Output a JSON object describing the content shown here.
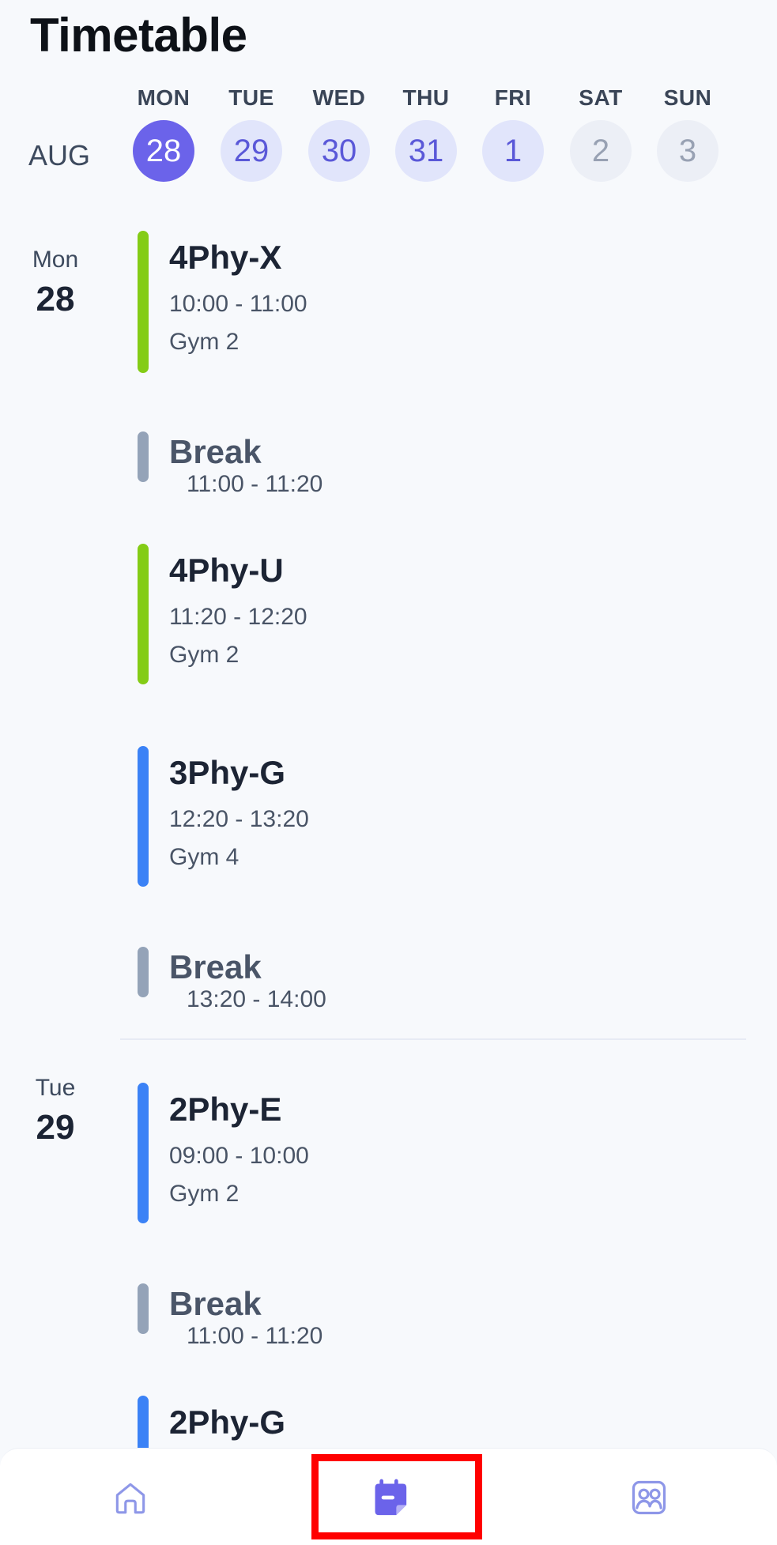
{
  "header": {
    "title": "Timetable"
  },
  "week": {
    "month": "AUG",
    "days": [
      {
        "dow": "MON",
        "date": "28",
        "state": "selected"
      },
      {
        "dow": "TUE",
        "date": "29",
        "state": "weekday"
      },
      {
        "dow": "WED",
        "date": "30",
        "state": "weekday"
      },
      {
        "dow": "THU",
        "date": "31",
        "state": "weekday"
      },
      {
        "dow": "FRI",
        "date": "1",
        "state": "weekday"
      },
      {
        "dow": "SAT",
        "date": "2",
        "state": "weekend"
      },
      {
        "dow": "SUN",
        "date": "3",
        "state": "weekend"
      }
    ]
  },
  "schedule": {
    "days": [
      {
        "day_name": "Mon",
        "day_number": "28",
        "entries": [
          {
            "type": "class",
            "name": "4Phy-X",
            "time": "10:00 - 11:00",
            "room": "Gym 2",
            "color": "green"
          },
          {
            "type": "break",
            "name": "Break",
            "time": "11:00 - 11:20"
          },
          {
            "type": "class",
            "name": "4Phy-U",
            "time": "11:20 - 12:20",
            "room": "Gym 2",
            "color": "green"
          },
          {
            "type": "class",
            "name": "3Phy-G",
            "time": "12:20 - 13:20",
            "room": "Gym 4",
            "color": "blue"
          },
          {
            "type": "break",
            "name": "Break",
            "time": "13:20 - 14:00"
          }
        ]
      },
      {
        "day_name": "Tue",
        "day_number": "29",
        "entries": [
          {
            "type": "class",
            "name": "2Phy-E",
            "time": "09:00 - 10:00",
            "room": "Gym 2",
            "color": "blue"
          },
          {
            "type": "break",
            "name": "Break",
            "time": "11:00 - 11:20"
          },
          {
            "type": "class",
            "name": "2Phy-G",
            "color": "blue"
          }
        ]
      }
    ]
  },
  "colors": {
    "accent": "#6b63ea",
    "green": "#84cc16",
    "blue": "#3b82f6",
    "gray": "#94a3b8",
    "highlight": "#ff0000"
  },
  "nav": {
    "items": [
      {
        "icon": "home-icon",
        "active": false
      },
      {
        "icon": "timetable-icon",
        "active": true
      },
      {
        "icon": "contacts-icon",
        "active": false
      }
    ]
  }
}
